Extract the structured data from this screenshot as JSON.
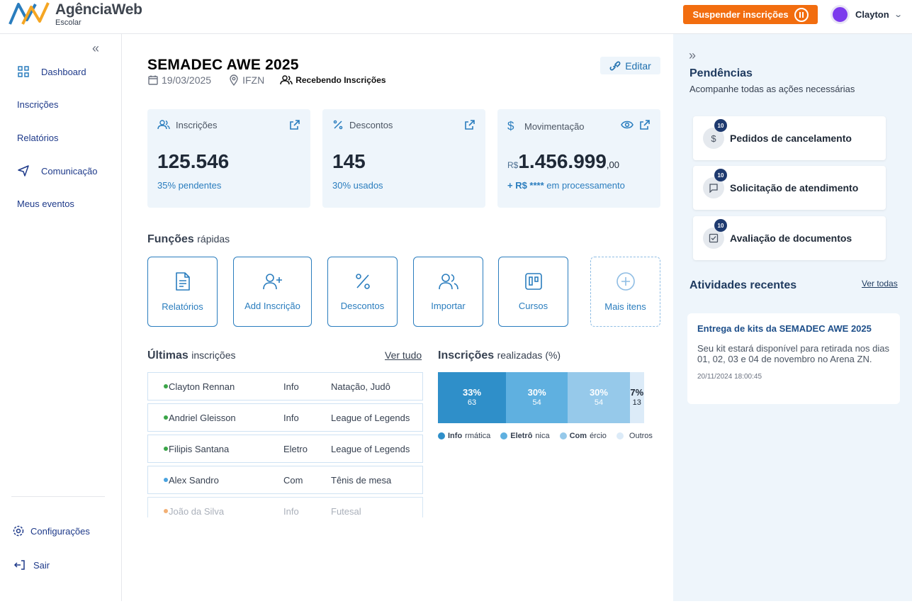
{
  "app": {
    "brand": "AgênciaWeb",
    "subtitle": "Escolar"
  },
  "topbar": {
    "suspend_label": "Suspender inscrições",
    "user_name": "Clayton"
  },
  "sidebar": {
    "items": [
      {
        "label": "Dashboard",
        "icon": "grid-icon"
      },
      {
        "label": "Inscrições"
      },
      {
        "label": "Relatórios"
      },
      {
        "label": "Comunicação",
        "icon": "send-icon"
      },
      {
        "label": "Meus eventos"
      }
    ],
    "bottom": [
      {
        "label": "Configurações",
        "icon": "gear-icon"
      },
      {
        "label": "Sair",
        "icon": "logout-icon"
      }
    ]
  },
  "event": {
    "title": "SEMADEC AWE 2025",
    "date": "19/03/2025",
    "place": "IFZN",
    "status": "Recebendo Inscrições",
    "edit_label": "Editar"
  },
  "cards": [
    {
      "label": "Inscrições",
      "value": "125.546",
      "sub": "35% pendentes"
    },
    {
      "label": "Descontos",
      "value": "145",
      "sub": "30% usados"
    },
    {
      "label": "Movimentação",
      "currency": "R$",
      "value": "1.456.999",
      "cents": ",00",
      "sub_bold": "+ R$ ****",
      "sub": " em processamento"
    }
  ],
  "quick": {
    "title_bold": "Funções",
    "title_rest": "rápidas",
    "items": [
      {
        "label": "Relatórios",
        "icon": "file-icon"
      },
      {
        "label": "Add Inscrição",
        "icon": "user-plus-icon"
      },
      {
        "label": "Descontos",
        "icon": "percent-icon"
      },
      {
        "label": "Importar",
        "icon": "users-icon"
      },
      {
        "label": "Cursos",
        "icon": "board-icon"
      },
      {
        "label": "Mais itens",
        "icon": "plus-circle-icon"
      }
    ]
  },
  "latest": {
    "title_bold": "Últimas",
    "title_rest": "inscrições",
    "see_all": "Ver tudo",
    "rows": [
      {
        "name": "Clayton Rennan",
        "course": "Info",
        "mod": "Natação, Judô",
        "color": "#3aa548"
      },
      {
        "name": "Andriel Gleisson",
        "course": "Info",
        "mod": "League of Legends",
        "color": "#3aa548"
      },
      {
        "name": "Filipis Santana",
        "course": "Eletro",
        "mod": "League of Legends",
        "color": "#3aa548"
      },
      {
        "name": "Alex Sandro",
        "course": "Com",
        "mod": "Tênis de mesa",
        "color": "#4aa3df"
      },
      {
        "name": "João da Silva",
        "course": "Info",
        "mod": "Futesal",
        "color": "#f0a35e"
      }
    ]
  },
  "chart": {
    "title_bold": "Inscrições",
    "title_rest": "realizadas (%)"
  },
  "chart_data": {
    "type": "bar",
    "categories": [
      "Informática",
      "Eletrônica",
      "Comércio",
      "Outros"
    ],
    "series": [
      {
        "values": [
          33,
          30,
          30,
          7
        ]
      },
      {
        "values": [
          63,
          54,
          54,
          13
        ]
      }
    ],
    "labels": [
      "33%",
      "30%",
      "30%",
      "7%"
    ],
    "counts": [
      "63",
      "54",
      "54",
      "13"
    ],
    "colors": [
      "#2f8fc9",
      "#5fb0e0",
      "#96c9ea",
      "#dcebf8"
    ],
    "legend": [
      {
        "bold": "Info",
        "rest": "rmática"
      },
      {
        "bold": "Eletrô",
        "rest": "nica"
      },
      {
        "bold": "Com",
        "rest": "ércio"
      },
      {
        "bold": "",
        "rest": "Outros"
      }
    ]
  },
  "pending": {
    "title": "Pendências",
    "subtitle": "Acompanhe todas as ações necessárias",
    "items": [
      {
        "label": "Pedidos de cancelamento",
        "badge": "10",
        "icon": "dollar-icon"
      },
      {
        "label": "Solicitação de atendimento",
        "badge": "10",
        "icon": "chat-icon"
      },
      {
        "label": "Avaliação de documentos",
        "badge": "10",
        "icon": "check-square-icon"
      }
    ]
  },
  "activities": {
    "title": "Atividades recentes",
    "see_all": "Ver todas",
    "item": {
      "title": "Entrega de kits da SEMADEC AWE 2025",
      "body": "Seu kit estará disponível para retirada nos dias 01, 02, 03 e 04 de novembro no Arena ZN.",
      "date": "20/11/2024 18:00:45"
    }
  }
}
